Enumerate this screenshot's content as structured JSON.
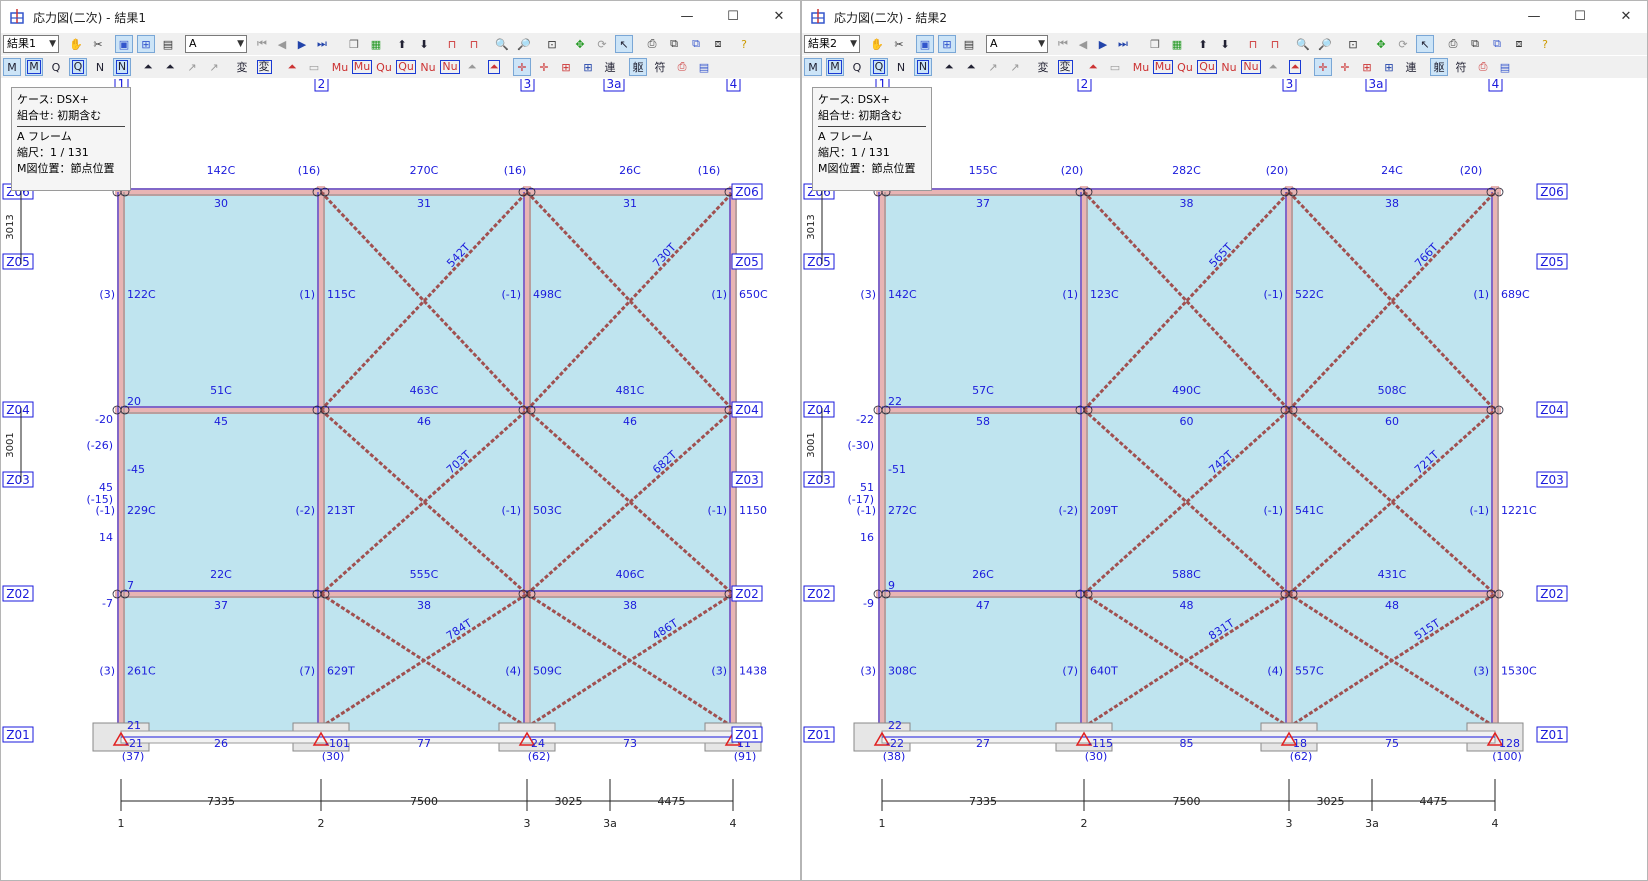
{
  "windows": [
    {
      "title": "応力図(二次) - 結果1",
      "result_select": "結果1",
      "frame_select": "A",
      "info": {
        "case": "ケース: DSX+",
        "combo": "組合せ: 初期含む",
        "frame": "A フレーム",
        "scale": "縮尺：1 / 131",
        "mpos": "M図位置：節点位置"
      },
      "beam_axial": [
        [
          "142C",
          "270C",
          "26C"
        ],
        [
          "51C",
          "463C",
          "481C"
        ],
        [
          "22C",
          "555C",
          "406C"
        ]
      ],
      "beam_shear": [
        [
          "30",
          "31",
          "31"
        ],
        [
          "45",
          "46",
          "46"
        ],
        [
          "37",
          "38",
          "38"
        ]
      ],
      "top_labels": [
        "(16)",
        "(16)",
        "(16)"
      ],
      "col_axial": [
        [
          "122C",
          "115C",
          "498C",
          "650C"
        ],
        [
          "229C",
          "213T",
          "503C",
          "1150"
        ],
        [
          "261C",
          "629T",
          "509C",
          "1438"
        ]
      ],
      "col_shear": [
        [
          "(3)",
          "(1)",
          "(-1)",
          "(1)"
        ],
        [
          "(-1)",
          "(-2)",
          "(-1)",
          "(-1)"
        ],
        [
          "(3)",
          "(7)",
          "(4)",
          "(3)"
        ]
      ],
      "brace": [
        [
          "542T",
          "730T"
        ],
        [
          "703T",
          "682T"
        ],
        [
          "784T",
          "486T"
        ]
      ],
      "base_beam": [
        "26",
        "77",
        "73"
      ],
      "base_reaction": [
        "-21",
        "-101",
        "24",
        "11"
      ],
      "base_paren": [
        "(37)",
        "(30)",
        "(62)",
        "(91)"
      ],
      "misc": {
        "left_m1": "-20",
        "left_p1": "(-26)",
        "left_m2": "45",
        "left_p2": "(-15)",
        "left_v3": "14",
        "left_m4": "-7",
        "left_c45": "-45",
        "left_n3": "20",
        "left_n2": "7",
        "left_n1": "21"
      }
    },
    {
      "title": "応力図(二次) - 結果2",
      "result_select": "結果2",
      "frame_select": "A",
      "info": {
        "case": "ケース: DSX+",
        "combo": "組合せ: 初期含む",
        "frame": "A フレーム",
        "scale": "縮尺：1 / 131",
        "mpos": "M図位置：節点位置"
      },
      "beam_axial": [
        [
          "155C",
          "282C",
          "24C"
        ],
        [
          "57C",
          "490C",
          "508C"
        ],
        [
          "26C",
          "588C",
          "431C"
        ]
      ],
      "beam_shear": [
        [
          "37",
          "38",
          "38"
        ],
        [
          "58",
          "60",
          "60"
        ],
        [
          "47",
          "48",
          "48"
        ]
      ],
      "top_labels": [
        "(20)",
        "(20)",
        "(20)"
      ],
      "col_axial": [
        [
          "142C",
          "123C",
          "522C",
          "689C"
        ],
        [
          "272C",
          "209T",
          "541C",
          "1221C"
        ],
        [
          "308C",
          "640T",
          "557C",
          "1530C"
        ]
      ],
      "col_shear": [
        [
          "(3)",
          "(1)",
          "(-1)",
          "(1)"
        ],
        [
          "(-1)",
          "(-2)",
          "(-1)",
          "(-1)"
        ],
        [
          "(3)",
          "(7)",
          "(4)",
          "(3)"
        ]
      ],
      "brace": [
        [
          "565T",
          "766T"
        ],
        [
          "742T",
          "721T"
        ],
        [
          "831T",
          "515T"
        ]
      ],
      "base_beam": [
        "27",
        "85",
        "75"
      ],
      "base_reaction": [
        "-22",
        "-115",
        "18",
        "128"
      ],
      "base_paren": [
        "(38)",
        "(30)",
        "(62)",
        "(100)"
      ],
      "misc": {
        "left_m1": "-22",
        "left_p1": "(-30)",
        "left_m2": "51",
        "left_p2": "(-17)",
        "left_v3": "16",
        "left_m4": "-9",
        "left_c45": "-51",
        "left_n3": "22",
        "left_n2": "9",
        "left_n1": "22"
      }
    }
  ],
  "grid": {
    "columns": [
      "1",
      "2",
      "3",
      "3a",
      "4"
    ],
    "spans": [
      "7335",
      "7500",
      "3025",
      "4475"
    ],
    "levels": [
      "Z06",
      "Z05",
      "Z04",
      "Z03",
      "Z02",
      "Z01"
    ],
    "heights": [
      "3013",
      "3001"
    ]
  },
  "toolbar": {
    "row2_letters": [
      "M",
      "M",
      "Q",
      "Q",
      "N",
      "N"
    ],
    "henkei": [
      "変",
      "変"
    ],
    "force_labels": [
      "Mu",
      "Mu",
      "Qu",
      "Qu",
      "Nu",
      "Nu"
    ],
    "ren": "連",
    "kumi": [
      "躯",
      "符"
    ]
  },
  "colors": {
    "panel": "#bfe4ef",
    "member": "#e8b4b4",
    "line": "#1a1adc",
    "support": "#e02020"
  }
}
